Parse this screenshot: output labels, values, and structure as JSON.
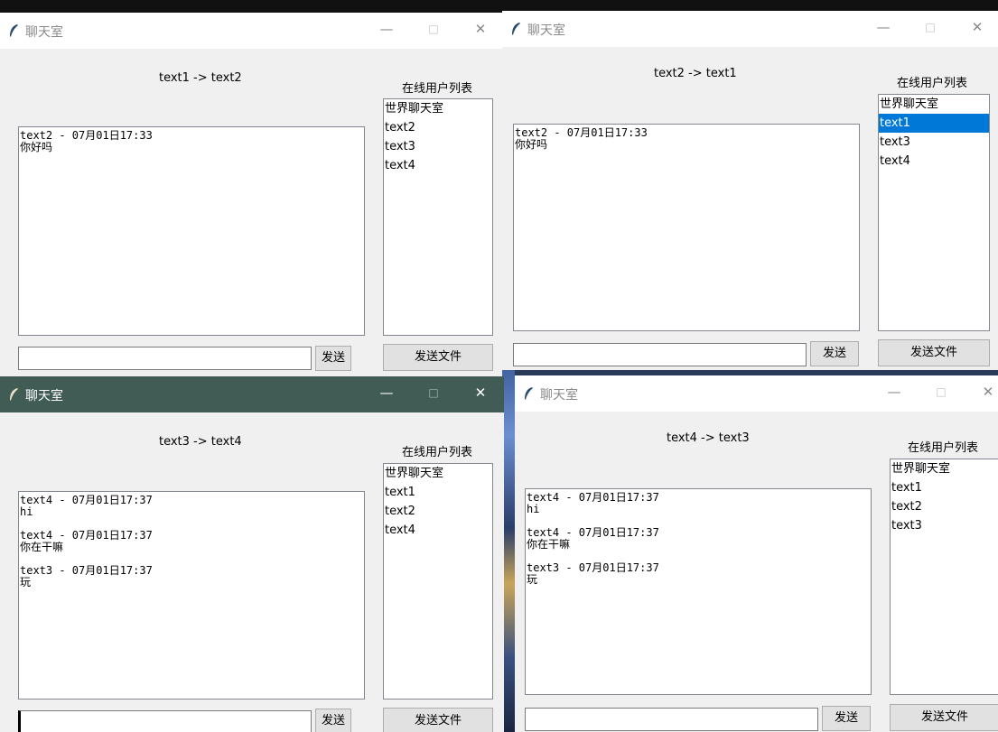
{
  "windows": [
    {
      "title": "聊天室",
      "route": "text1 -> text2",
      "users_label": "在线用户列表",
      "users": [
        "世界聊天室",
        "text2",
        "text3",
        "text4"
      ],
      "selected_user": -1,
      "messages": [
        {
          "header": "text2 - 07月01日17:33",
          "body": "你好吗"
        }
      ],
      "input_value": "",
      "send_label": "发送",
      "send_file_label": "发送文件",
      "controls": {
        "minimize": "—",
        "maximize": "□",
        "close": "✕"
      }
    },
    {
      "title": "聊天室",
      "route": "text2 -> text1",
      "users_label": "在线用户列表",
      "users": [
        "世界聊天室",
        "text1",
        "text3",
        "text4"
      ],
      "selected_user": 1,
      "messages": [
        {
          "header": "text2 - 07月01日17:33",
          "body": "你好吗"
        }
      ],
      "input_value": "",
      "send_label": "发送",
      "send_file_label": "发送文件",
      "controls": {
        "minimize": "—",
        "maximize": "□",
        "close": "✕"
      }
    },
    {
      "title": "聊天室",
      "route": "text3 -> text4",
      "users_label": "在线用户列表",
      "users": [
        "世界聊天室",
        "text1",
        "text2",
        "text4"
      ],
      "selected_user": -1,
      "messages": [
        {
          "header": "text4 - 07月01日17:37",
          "body": "hi"
        },
        {
          "header": "text4 - 07月01日17:37",
          "body": "你在干嘛"
        },
        {
          "header": "text3 - 07月01日17:37",
          "body": "玩"
        }
      ],
      "input_value": "",
      "send_label": "发送",
      "send_file_label": "发送文件",
      "active": true,
      "controls": {
        "minimize": "—",
        "maximize": "□",
        "close": "✕"
      }
    },
    {
      "title": "聊天室",
      "route": "text4 -> text3",
      "users_label": "在线用户列表",
      "users": [
        "世界聊天室",
        "text1",
        "text2",
        "text3"
      ],
      "selected_user": -1,
      "messages": [
        {
          "header": "text4 - 07月01日17:37",
          "body": "hi"
        },
        {
          "header": "text4 - 07月01日17:37",
          "body": "你在干嘛"
        },
        {
          "header": "text3 - 07月01日17:37",
          "body": "玩"
        }
      ],
      "input_value": "",
      "send_label": "发送",
      "send_file_label": "发送文件",
      "controls": {
        "minimize": "—",
        "maximize": "□",
        "close": "✕"
      }
    }
  ],
  "colors": {
    "selection": "#0078d7",
    "active_titlebar": "#415b55",
    "window_bg": "#f0f0f0"
  }
}
